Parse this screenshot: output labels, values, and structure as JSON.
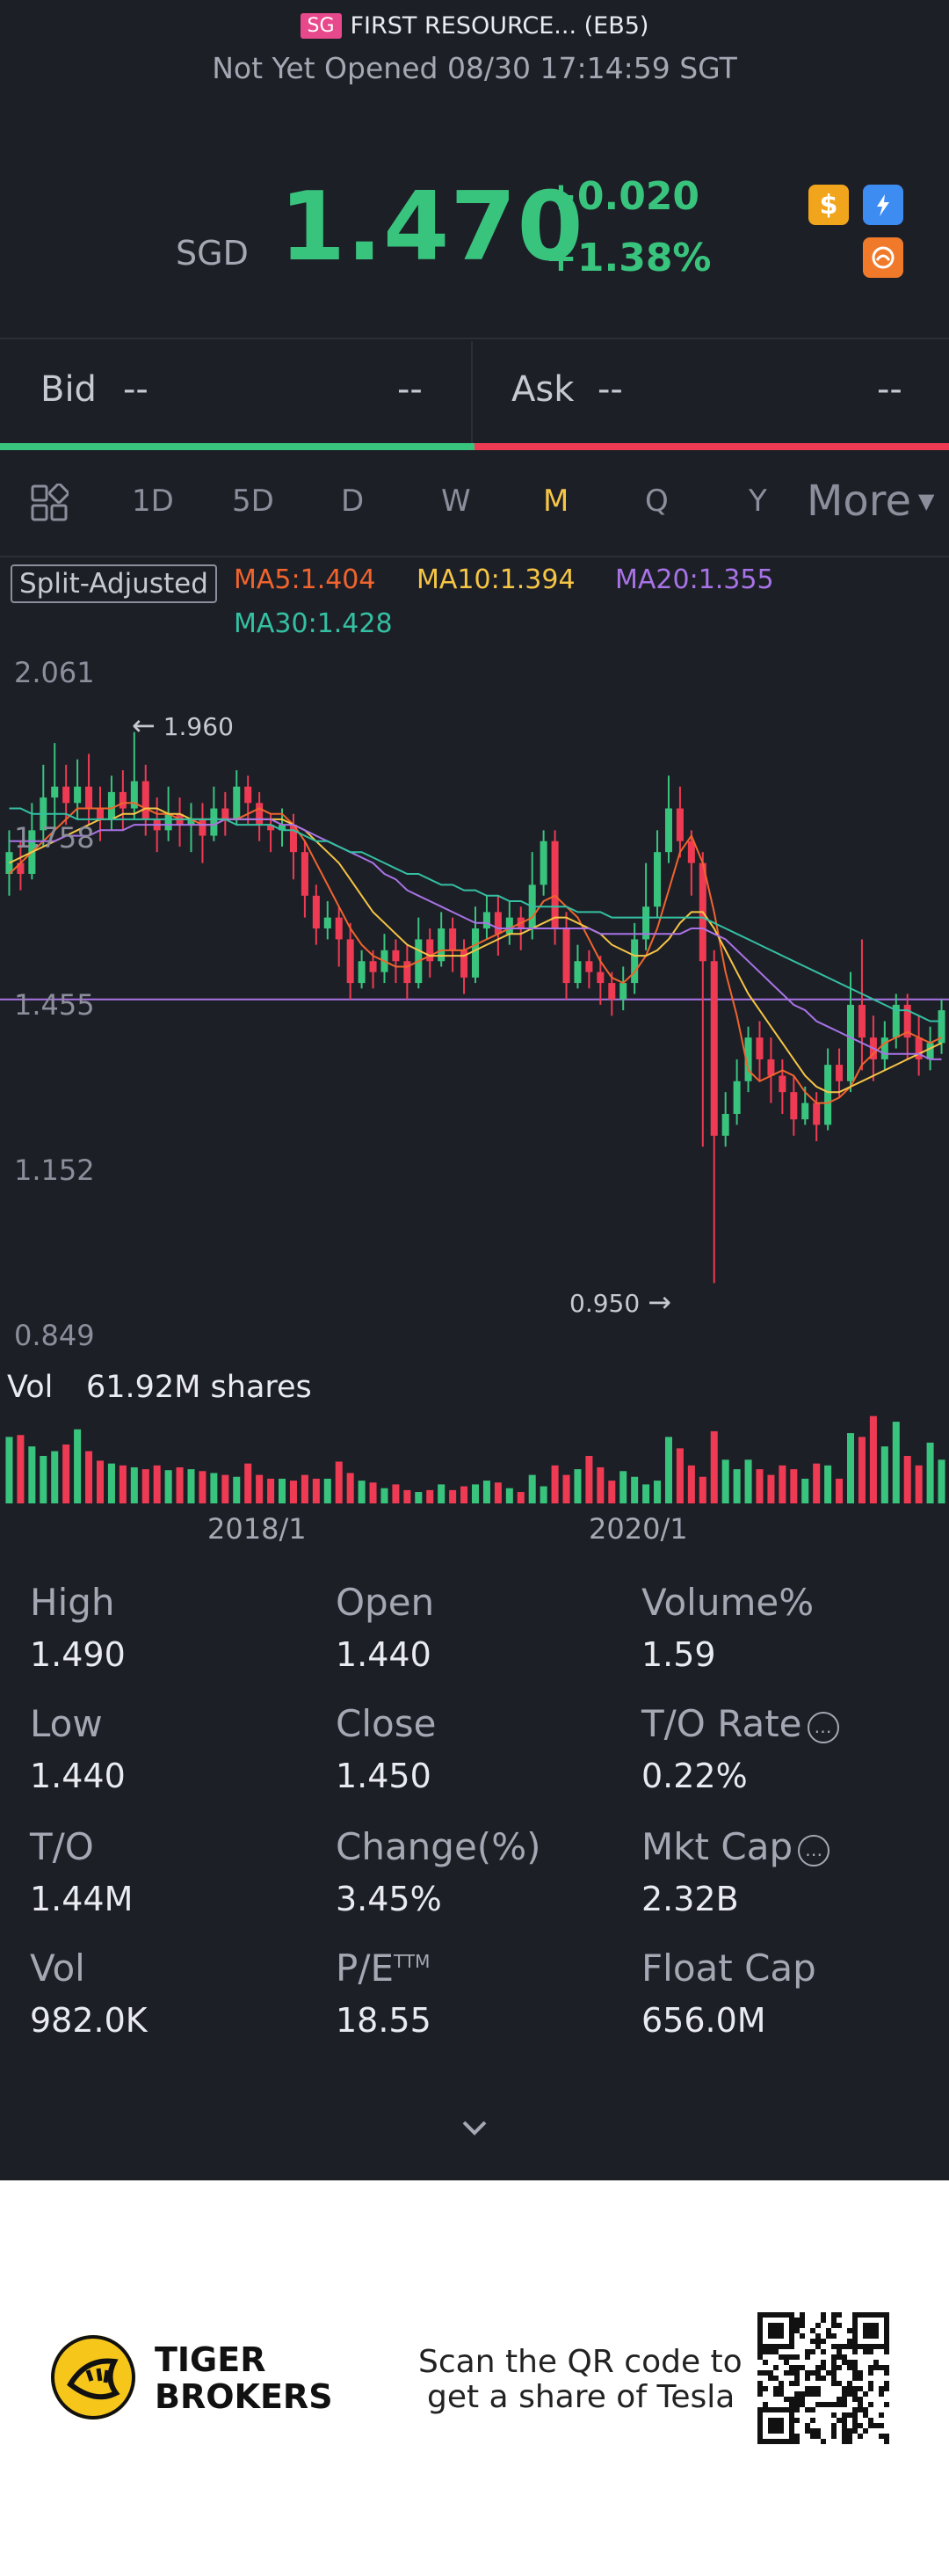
{
  "header": {
    "market_badge": "SG",
    "title": "FIRST RESOURCE... (EB5)",
    "status": "Not Yet Opened 08/30 17:14:59 SGT",
    "currency": "SGD",
    "price": "1.470",
    "change": "+0.020",
    "change_pct": "+1.38%",
    "icons": [
      "dollar-icon",
      "flash-icon",
      "brand-icon"
    ]
  },
  "bidask": {
    "bid_label": "Bid",
    "bid_value": "--",
    "bid_size": "--",
    "ask_label": "Ask",
    "ask_value": "--",
    "ask_size": "--"
  },
  "tabs": {
    "items": [
      "1D",
      "5D",
      "D",
      "W",
      "M",
      "Q",
      "Y"
    ],
    "active": "M",
    "more": "More"
  },
  "ma": {
    "split": "Split-Adjusted",
    "ma5": "MA5:1.404",
    "ma10": "MA10:1.394",
    "ma20": "MA20:1.355",
    "ma30": "MA30:1.428",
    "colors": {
      "ma5": "#f0642d",
      "ma10": "#f6c545",
      "ma20": "#a873e6",
      "ma30": "#34c0a2"
    }
  },
  "chart": {
    "y_labels": [
      "2.061",
      "1.758",
      "1.455",
      "1.152",
      "0.849"
    ],
    "high_marker": "1.960",
    "low_marker": "0.950",
    "volume_label": "Vol",
    "volume_value": "61.92M shares",
    "x_labels": [
      "2018/1",
      "2020/1"
    ]
  },
  "chart_data": {
    "type": "candlestick",
    "ylim": [
      0.849,
      2.061
    ],
    "up_color": "#39c47e",
    "down_color": "#ee3b53",
    "candles": [
      [
        1.7,
        1.74,
        1.66,
        1.78,
        1
      ],
      [
        1.72,
        1.7,
        1.67,
        1.76,
        0
      ],
      [
        1.7,
        1.78,
        1.69,
        1.83,
        1
      ],
      [
        1.78,
        1.84,
        1.75,
        1.9,
        1
      ],
      [
        1.84,
        1.86,
        1.78,
        1.94,
        1
      ],
      [
        1.86,
        1.83,
        1.79,
        1.9,
        0
      ],
      [
        1.83,
        1.86,
        1.8,
        1.91,
        1
      ],
      [
        1.86,
        1.82,
        1.79,
        1.92,
        0
      ],
      [
        1.82,
        1.8,
        1.76,
        1.86,
        0
      ],
      [
        1.8,
        1.85,
        1.78,
        1.88,
        1
      ],
      [
        1.85,
        1.82,
        1.78,
        1.89,
        0
      ],
      [
        1.82,
        1.87,
        1.8,
        1.96,
        1
      ],
      [
        1.87,
        1.8,
        1.77,
        1.9,
        0
      ],
      [
        1.8,
        1.78,
        1.74,
        1.84,
        0
      ],
      [
        1.78,
        1.81,
        1.76,
        1.86,
        1
      ],
      [
        1.81,
        1.79,
        1.75,
        1.84,
        0
      ],
      [
        1.79,
        1.8,
        1.74,
        1.83,
        1
      ],
      [
        1.8,
        1.77,
        1.72,
        1.83,
        0
      ],
      [
        1.77,
        1.82,
        1.76,
        1.86,
        1
      ],
      [
        1.82,
        1.8,
        1.77,
        1.85,
        0
      ],
      [
        1.8,
        1.86,
        1.79,
        1.89,
        1
      ],
      [
        1.86,
        1.83,
        1.79,
        1.88,
        0
      ],
      [
        1.83,
        1.79,
        1.76,
        1.85,
        0
      ],
      [
        1.79,
        1.78,
        1.74,
        1.81,
        0
      ],
      [
        1.78,
        1.79,
        1.75,
        1.82,
        1
      ],
      [
        1.79,
        1.74,
        1.69,
        1.81,
        0
      ],
      [
        1.74,
        1.66,
        1.62,
        1.76,
        0
      ],
      [
        1.66,
        1.6,
        1.57,
        1.68,
        0
      ],
      [
        1.6,
        1.62,
        1.58,
        1.65,
        1
      ],
      [
        1.62,
        1.58,
        1.53,
        1.64,
        0
      ],
      [
        1.58,
        1.5,
        1.47,
        1.61,
        0
      ],
      [
        1.5,
        1.54,
        1.49,
        1.56,
        1
      ],
      [
        1.54,
        1.52,
        1.49,
        1.56,
        0
      ],
      [
        1.52,
        1.56,
        1.5,
        1.59,
        1
      ],
      [
        1.56,
        1.54,
        1.5,
        1.58,
        0
      ],
      [
        1.54,
        1.5,
        1.47,
        1.57,
        0
      ],
      [
        1.5,
        1.58,
        1.49,
        1.62,
        1
      ],
      [
        1.58,
        1.54,
        1.51,
        1.6,
        0
      ],
      [
        1.54,
        1.6,
        1.53,
        1.63,
        1
      ],
      [
        1.6,
        1.56,
        1.52,
        1.62,
        0
      ],
      [
        1.56,
        1.51,
        1.48,
        1.58,
        0
      ],
      [
        1.51,
        1.6,
        1.5,
        1.64,
        1
      ],
      [
        1.6,
        1.63,
        1.58,
        1.66,
        1
      ],
      [
        1.63,
        1.59,
        1.55,
        1.66,
        0
      ],
      [
        1.59,
        1.62,
        1.57,
        1.65,
        1
      ],
      [
        1.62,
        1.6,
        1.56,
        1.64,
        0
      ],
      [
        1.6,
        1.68,
        1.58,
        1.74,
        1
      ],
      [
        1.68,
        1.76,
        1.66,
        1.78,
        1
      ],
      [
        1.76,
        1.6,
        1.57,
        1.78,
        0
      ],
      [
        1.6,
        1.5,
        1.47,
        1.63,
        0
      ],
      [
        1.5,
        1.54,
        1.49,
        1.57,
        1
      ],
      [
        1.54,
        1.52,
        1.49,
        1.56,
        0
      ],
      [
        1.52,
        1.5,
        1.46,
        1.55,
        0
      ],
      [
        1.5,
        1.47,
        1.44,
        1.52,
        0
      ],
      [
        1.47,
        1.5,
        1.45,
        1.53,
        1
      ],
      [
        1.5,
        1.58,
        1.48,
        1.61,
        1
      ],
      [
        1.58,
        1.64,
        1.56,
        1.72,
        1
      ],
      [
        1.64,
        1.74,
        1.62,
        1.78,
        1
      ],
      [
        1.74,
        1.82,
        1.72,
        1.88,
        1
      ],
      [
        1.82,
        1.76,
        1.73,
        1.86,
        0
      ],
      [
        1.76,
        1.72,
        1.66,
        1.78,
        0
      ],
      [
        1.72,
        1.54,
        1.2,
        1.74,
        0
      ],
      [
        1.54,
        1.22,
        0.95,
        1.56,
        0
      ],
      [
        1.22,
        1.26,
        1.2,
        1.3,
        1
      ],
      [
        1.26,
        1.32,
        1.24,
        1.36,
        1
      ],
      [
        1.32,
        1.4,
        1.3,
        1.42,
        1
      ],
      [
        1.4,
        1.36,
        1.32,
        1.43,
        0
      ],
      [
        1.36,
        1.33,
        1.28,
        1.4,
        0
      ],
      [
        1.33,
        1.3,
        1.26,
        1.36,
        0
      ],
      [
        1.3,
        1.25,
        1.22,
        1.33,
        0
      ],
      [
        1.25,
        1.28,
        1.24,
        1.31,
        1
      ],
      [
        1.28,
        1.24,
        1.21,
        1.3,
        0
      ],
      [
        1.24,
        1.35,
        1.23,
        1.38,
        1
      ],
      [
        1.35,
        1.32,
        1.29,
        1.38,
        0
      ],
      [
        1.32,
        1.46,
        1.3,
        1.52,
        1
      ],
      [
        1.46,
        1.4,
        1.34,
        1.58,
        0
      ],
      [
        1.4,
        1.36,
        1.32,
        1.44,
        0
      ],
      [
        1.36,
        1.4,
        1.34,
        1.43,
        1
      ],
      [
        1.4,
        1.46,
        1.38,
        1.48,
        1
      ],
      [
        1.46,
        1.4,
        1.36,
        1.48,
        0
      ],
      [
        1.4,
        1.36,
        1.33,
        1.44,
        0
      ],
      [
        1.36,
        1.39,
        1.34,
        1.42,
        1
      ],
      [
        1.39,
        1.45,
        1.37,
        1.47,
        1
      ]
    ],
    "ma5": [
      1.7,
      1.72,
      1.74,
      1.76,
      1.78,
      1.8,
      1.82,
      1.82,
      1.82,
      1.82,
      1.83,
      1.83,
      1.82,
      1.81,
      1.81,
      1.8,
      1.8,
      1.79,
      1.79,
      1.8,
      1.8,
      1.81,
      1.82,
      1.81,
      1.81,
      1.79,
      1.76,
      1.72,
      1.68,
      1.64,
      1.6,
      1.57,
      1.55,
      1.54,
      1.53,
      1.53,
      1.54,
      1.55,
      1.56,
      1.56,
      1.56,
      1.57,
      1.58,
      1.59,
      1.6,
      1.61,
      1.62,
      1.65,
      1.66,
      1.64,
      1.62,
      1.58,
      1.54,
      1.51,
      1.5,
      1.52,
      1.55,
      1.6,
      1.67,
      1.74,
      1.77,
      1.72,
      1.63,
      1.52,
      1.44,
      1.34,
      1.32,
      1.33,
      1.34,
      1.33,
      1.3,
      1.28,
      1.28,
      1.29,
      1.31,
      1.35,
      1.37,
      1.39,
      1.4,
      1.41,
      1.4,
      1.39,
      1.4
    ],
    "ma10": [
      1.72,
      1.73,
      1.74,
      1.75,
      1.76,
      1.77,
      1.78,
      1.79,
      1.8,
      1.8,
      1.81,
      1.81,
      1.82,
      1.82,
      1.81,
      1.81,
      1.8,
      1.8,
      1.8,
      1.8,
      1.8,
      1.8,
      1.8,
      1.8,
      1.8,
      1.79,
      1.78,
      1.76,
      1.74,
      1.72,
      1.69,
      1.66,
      1.63,
      1.61,
      1.59,
      1.57,
      1.56,
      1.55,
      1.55,
      1.55,
      1.55,
      1.56,
      1.57,
      1.58,
      1.59,
      1.59,
      1.6,
      1.61,
      1.62,
      1.62,
      1.61,
      1.6,
      1.59,
      1.57,
      1.56,
      1.55,
      1.55,
      1.56,
      1.58,
      1.61,
      1.63,
      1.63,
      1.6,
      1.56,
      1.52,
      1.48,
      1.45,
      1.42,
      1.39,
      1.36,
      1.33,
      1.31,
      1.3,
      1.3,
      1.31,
      1.32,
      1.33,
      1.34,
      1.35,
      1.36,
      1.37,
      1.38,
      1.39
    ],
    "ma20": [
      1.76,
      1.76,
      1.76,
      1.76,
      1.76,
      1.77,
      1.77,
      1.77,
      1.78,
      1.78,
      1.78,
      1.79,
      1.79,
      1.79,
      1.79,
      1.79,
      1.79,
      1.79,
      1.79,
      1.8,
      1.8,
      1.8,
      1.8,
      1.8,
      1.79,
      1.79,
      1.78,
      1.77,
      1.76,
      1.75,
      1.74,
      1.73,
      1.72,
      1.7,
      1.69,
      1.67,
      1.66,
      1.65,
      1.64,
      1.63,
      1.62,
      1.61,
      1.61,
      1.6,
      1.6,
      1.6,
      1.6,
      1.6,
      1.6,
      1.6,
      1.6,
      1.6,
      1.59,
      1.59,
      1.59,
      1.59,
      1.59,
      1.59,
      1.59,
      1.59,
      1.6,
      1.6,
      1.59,
      1.58,
      1.56,
      1.54,
      1.52,
      1.5,
      1.48,
      1.46,
      1.45,
      1.43,
      1.42,
      1.41,
      1.4,
      1.39,
      1.38,
      1.37,
      1.37,
      1.37,
      1.37,
      1.36,
      1.36
    ],
    "ma30": [
      1.82,
      1.82,
      1.81,
      1.81,
      1.81,
      1.81,
      1.8,
      1.8,
      1.8,
      1.8,
      1.8,
      1.8,
      1.8,
      1.8,
      1.8,
      1.8,
      1.8,
      1.8,
      1.8,
      1.8,
      1.79,
      1.79,
      1.79,
      1.79,
      1.78,
      1.78,
      1.77,
      1.76,
      1.76,
      1.75,
      1.74,
      1.74,
      1.73,
      1.72,
      1.71,
      1.7,
      1.7,
      1.69,
      1.68,
      1.68,
      1.67,
      1.67,
      1.66,
      1.66,
      1.65,
      1.65,
      1.64,
      1.64,
      1.64,
      1.64,
      1.63,
      1.63,
      1.63,
      1.62,
      1.62,
      1.62,
      1.62,
      1.62,
      1.62,
      1.62,
      1.62,
      1.62,
      1.61,
      1.6,
      1.59,
      1.58,
      1.57,
      1.56,
      1.55,
      1.54,
      1.53,
      1.52,
      1.51,
      1.5,
      1.49,
      1.48,
      1.47,
      1.46,
      1.45,
      1.45,
      1.44,
      1.43,
      1.43
    ],
    "current_price": 1.47,
    "volumes": [
      0.7,
      0.72,
      0.6,
      0.5,
      0.55,
      0.62,
      0.78,
      0.55,
      0.45,
      0.42,
      0.4,
      0.38,
      0.36,
      0.4,
      0.35,
      0.38,
      0.36,
      0.34,
      0.32,
      0.3,
      0.28,
      0.42,
      0.3,
      0.26,
      0.26,
      0.24,
      0.3,
      0.26,
      0.26,
      0.44,
      0.32,
      0.24,
      0.22,
      0.16,
      0.2,
      0.14,
      0.12,
      0.14,
      0.2,
      0.14,
      0.18,
      0.2,
      0.24,
      0.22,
      0.16,
      0.12,
      0.3,
      0.18,
      0.4,
      0.3,
      0.36,
      0.5,
      0.38,
      0.24,
      0.34,
      0.28,
      0.2,
      0.24,
      0.7,
      0.58,
      0.4,
      0.28,
      0.76,
      0.46,
      0.36,
      0.46,
      0.36,
      0.3,
      0.4,
      0.36,
      0.26,
      0.42,
      0.4,
      0.26,
      0.74,
      0.7,
      0.92,
      0.6,
      0.86,
      0.5,
      0.4,
      0.64,
      0.46,
      0.26,
      0.2
    ]
  },
  "stats": [
    {
      "label": "High",
      "value": "1.490"
    },
    {
      "label": "Open",
      "value": "1.440"
    },
    {
      "label": "Volume%",
      "value": "1.59"
    },
    {
      "label": "Low",
      "value": "1.440"
    },
    {
      "label": "Close",
      "value": "1.450"
    },
    {
      "label": "T/O Rate",
      "value": "0.22%"
    },
    {
      "label": "T/O",
      "value": "1.44M"
    },
    {
      "label": "Change(%)",
      "value": "3.45%"
    },
    {
      "label": "Mkt Cap",
      "value": "2.32B"
    },
    {
      "label": "Vol",
      "value": "982.0K"
    },
    {
      "label": "P/E",
      "value": "18.55"
    },
    {
      "label": "Float Cap",
      "value": "656.0M"
    }
  ],
  "stats_extra": {
    "pe_sup": "TTM",
    "info_glyph": "…"
  },
  "footer": {
    "brand1": "TIGER",
    "brand2": "BROKERS",
    "scan1": "Scan the QR code to",
    "scan2": "get a share of Tesla"
  }
}
